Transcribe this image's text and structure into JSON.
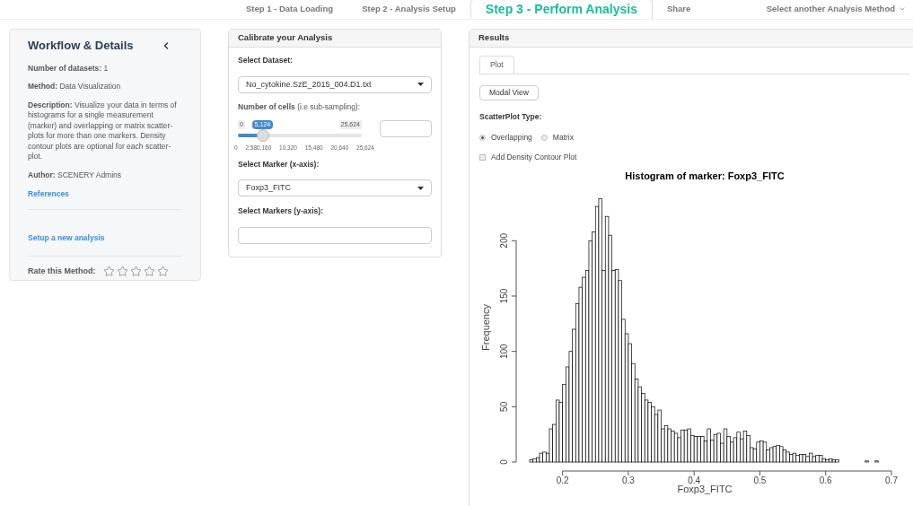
{
  "nav_tabs": [
    {
      "label": "Step 1 - Data Loading",
      "selected": false
    },
    {
      "label": "Step 2 - Analysis Setup",
      "selected": false
    },
    {
      "label": "Step 3 - Perform Analysis",
      "selected": true
    },
    {
      "label": "Share",
      "selected": false
    }
  ],
  "method_menu": {
    "label": "Select another Analysis Method"
  },
  "sidebar": {
    "title": "Workflow & Details",
    "fields": [
      "**Number of datasets:** 1",
      "**Method:** Data Visualization",
      "**Description:** Visualize your data in terms of histograms for a single measurement (marker) and overlapping or matrix scatter-plots for more than one markers. Density contour plots are optional for each scatter-plot.",
      "**Author:** SCENERY Admins"
    ],
    "links": [
      "References",
      "Setup a new analysis"
    ],
    "rating": {
      "label": "Rate this Method:",
      "stars": 0
    }
  },
  "calibrate": {
    "title": "Calibrate your Analysis",
    "dataset": {
      "label": "Select Dataset:",
      "value": "No_cytokine.SzE_2015_004.D1.txt"
    },
    "cells": {
      "label": "**Number of cells** (i.e sub-sampling):",
      "min_label": "0",
      "max_label": "25,624",
      "value": "5,124",
      "level": 0.2,
      "ticks": [
        "0",
        "2,580,160",
        "10,320",
        "15,480",
        "20,640",
        "25,624"
      ]
    },
    "marker_x": {
      "label": "Select Marker (x-axis):",
      "value": "Foxp3_FITC"
    },
    "markers_y": {
      "label": "Select Markers (y-axis):"
    }
  },
  "results": {
    "title": "Results",
    "tabs": [
      {
        "label": "Plot",
        "selected": true
      }
    ],
    "button": "Modal View",
    "scatter_type": {
      "label": "ScatterPlot Type:",
      "options": [
        {
          "label": "Overlapping",
          "selected": true
        },
        {
          "label": "Matrix",
          "selected": false
        }
      ]
    },
    "density": {
      "label": "Add Density Contour Plot",
      "checked": false
    },
    "chart_data": {
      "type": "bar",
      "title": "Histogram of marker: Foxp3_FITC",
      "xlabel": "Foxp3_FITC",
      "ylabel": "Frequency",
      "xlim": [
        0.15,
        0.7
      ],
      "ylim": [
        0,
        240
      ],
      "xticks": [
        0.2,
        0.3,
        0.4,
        0.5,
        0.6,
        0.7
      ],
      "yticks": [
        0,
        50,
        100,
        150,
        200
      ],
      "x": [
        0.15,
        0.155,
        0.16,
        0.165,
        0.17,
        0.175,
        0.18,
        0.185,
        0.19,
        0.195,
        0.2,
        0.205,
        0.21,
        0.215,
        0.22,
        0.225,
        0.23,
        0.235,
        0.24,
        0.245,
        0.25,
        0.255,
        0.26,
        0.265,
        0.27,
        0.275,
        0.28,
        0.285,
        0.29,
        0.295,
        0.3,
        0.305,
        0.31,
        0.315,
        0.32,
        0.325,
        0.33,
        0.335,
        0.34,
        0.345,
        0.35,
        0.355,
        0.36,
        0.365,
        0.37,
        0.375,
        0.38,
        0.385,
        0.39,
        0.395,
        0.4,
        0.405,
        0.41,
        0.415,
        0.42,
        0.425,
        0.43,
        0.435,
        0.44,
        0.445,
        0.45,
        0.455,
        0.46,
        0.465,
        0.47,
        0.475,
        0.48,
        0.485,
        0.49,
        0.495,
        0.5,
        0.505,
        0.51,
        0.515,
        0.52,
        0.525,
        0.53,
        0.535,
        0.54,
        0.545,
        0.55,
        0.555,
        0.56,
        0.565,
        0.57,
        0.575,
        0.58,
        0.585,
        0.59,
        0.595,
        0.6,
        0.605,
        0.61,
        0.615,
        0.62,
        0.625,
        0.63,
        0.635,
        0.64,
        0.645,
        0.65,
        0.655,
        0.66,
        0.665,
        0.67,
        0.675
      ],
      "values": [
        2,
        3,
        4,
        8,
        9,
        8,
        30,
        34,
        56,
        54,
        70,
        86,
        100,
        120,
        143,
        158,
        167,
        173,
        200,
        208,
        231,
        238,
        173,
        222,
        205,
        173,
        174,
        164,
        129,
        116,
        107,
        89,
        75,
        68,
        62,
        56,
        54,
        50,
        43,
        47,
        30,
        33,
        30,
        28,
        26,
        22,
        29,
        29,
        30,
        24,
        23,
        23,
        23,
        19,
        30,
        20,
        25,
        26,
        17,
        30,
        23,
        18,
        22,
        27,
        21,
        28,
        24,
        13,
        12,
        18,
        19,
        18,
        11,
        13,
        14,
        15,
        14,
        11,
        9,
        7,
        8,
        6,
        7,
        7,
        5,
        8,
        5,
        6,
        6,
        3,
        2,
        3,
        2,
        2,
        0,
        0,
        0,
        0,
        0,
        0,
        0,
        0,
        1,
        0,
        0,
        1
      ]
    }
  }
}
